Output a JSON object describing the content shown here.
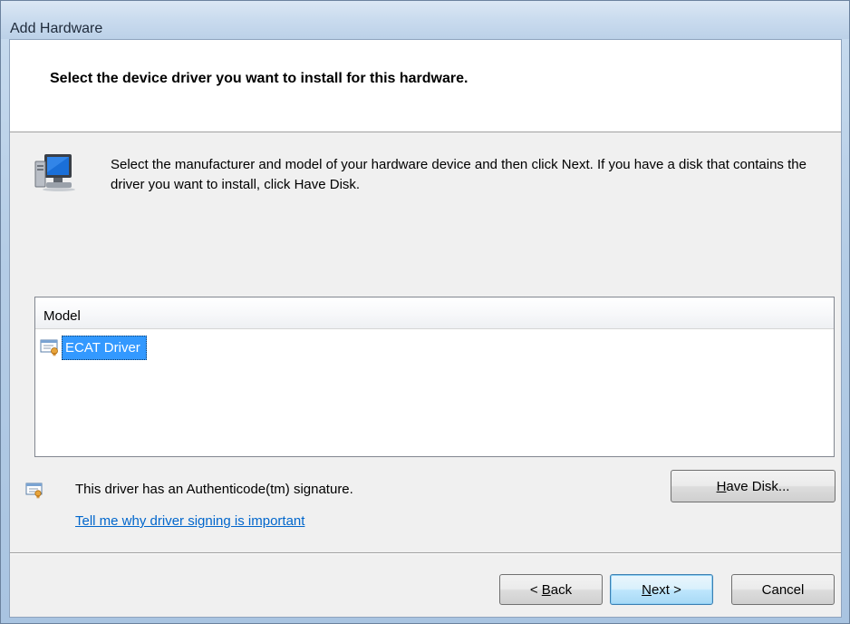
{
  "window": {
    "title": "Add Hardware"
  },
  "header": {
    "title": "Select the device driver you want to install for this hardware."
  },
  "instructions": {
    "text": "Select the manufacturer and model of your hardware device and then click Next. If you have a disk that contains the driver you want to install, click Have Disk."
  },
  "model_list": {
    "column_header": "Model",
    "items": [
      {
        "label": "ECAT Driver",
        "icon": "driver-certificate-icon",
        "selected": true
      }
    ]
  },
  "signature": {
    "text": "This driver has an Authenticode(tm) signature.",
    "link": "Tell me why driver signing is important",
    "icon": "certificate-icon"
  },
  "buttons": {
    "have_disk": {
      "accel": "H",
      "rest": "ave Disk..."
    },
    "back": {
      "prefix": "< ",
      "accel": "B",
      "rest": "ack"
    },
    "next": {
      "accel": "N",
      "rest": "ext >"
    },
    "cancel": "Cancel"
  },
  "colors": {
    "selection": "#3399ff",
    "link": "#0066cc",
    "dialog_background": "#f0f0f0"
  }
}
